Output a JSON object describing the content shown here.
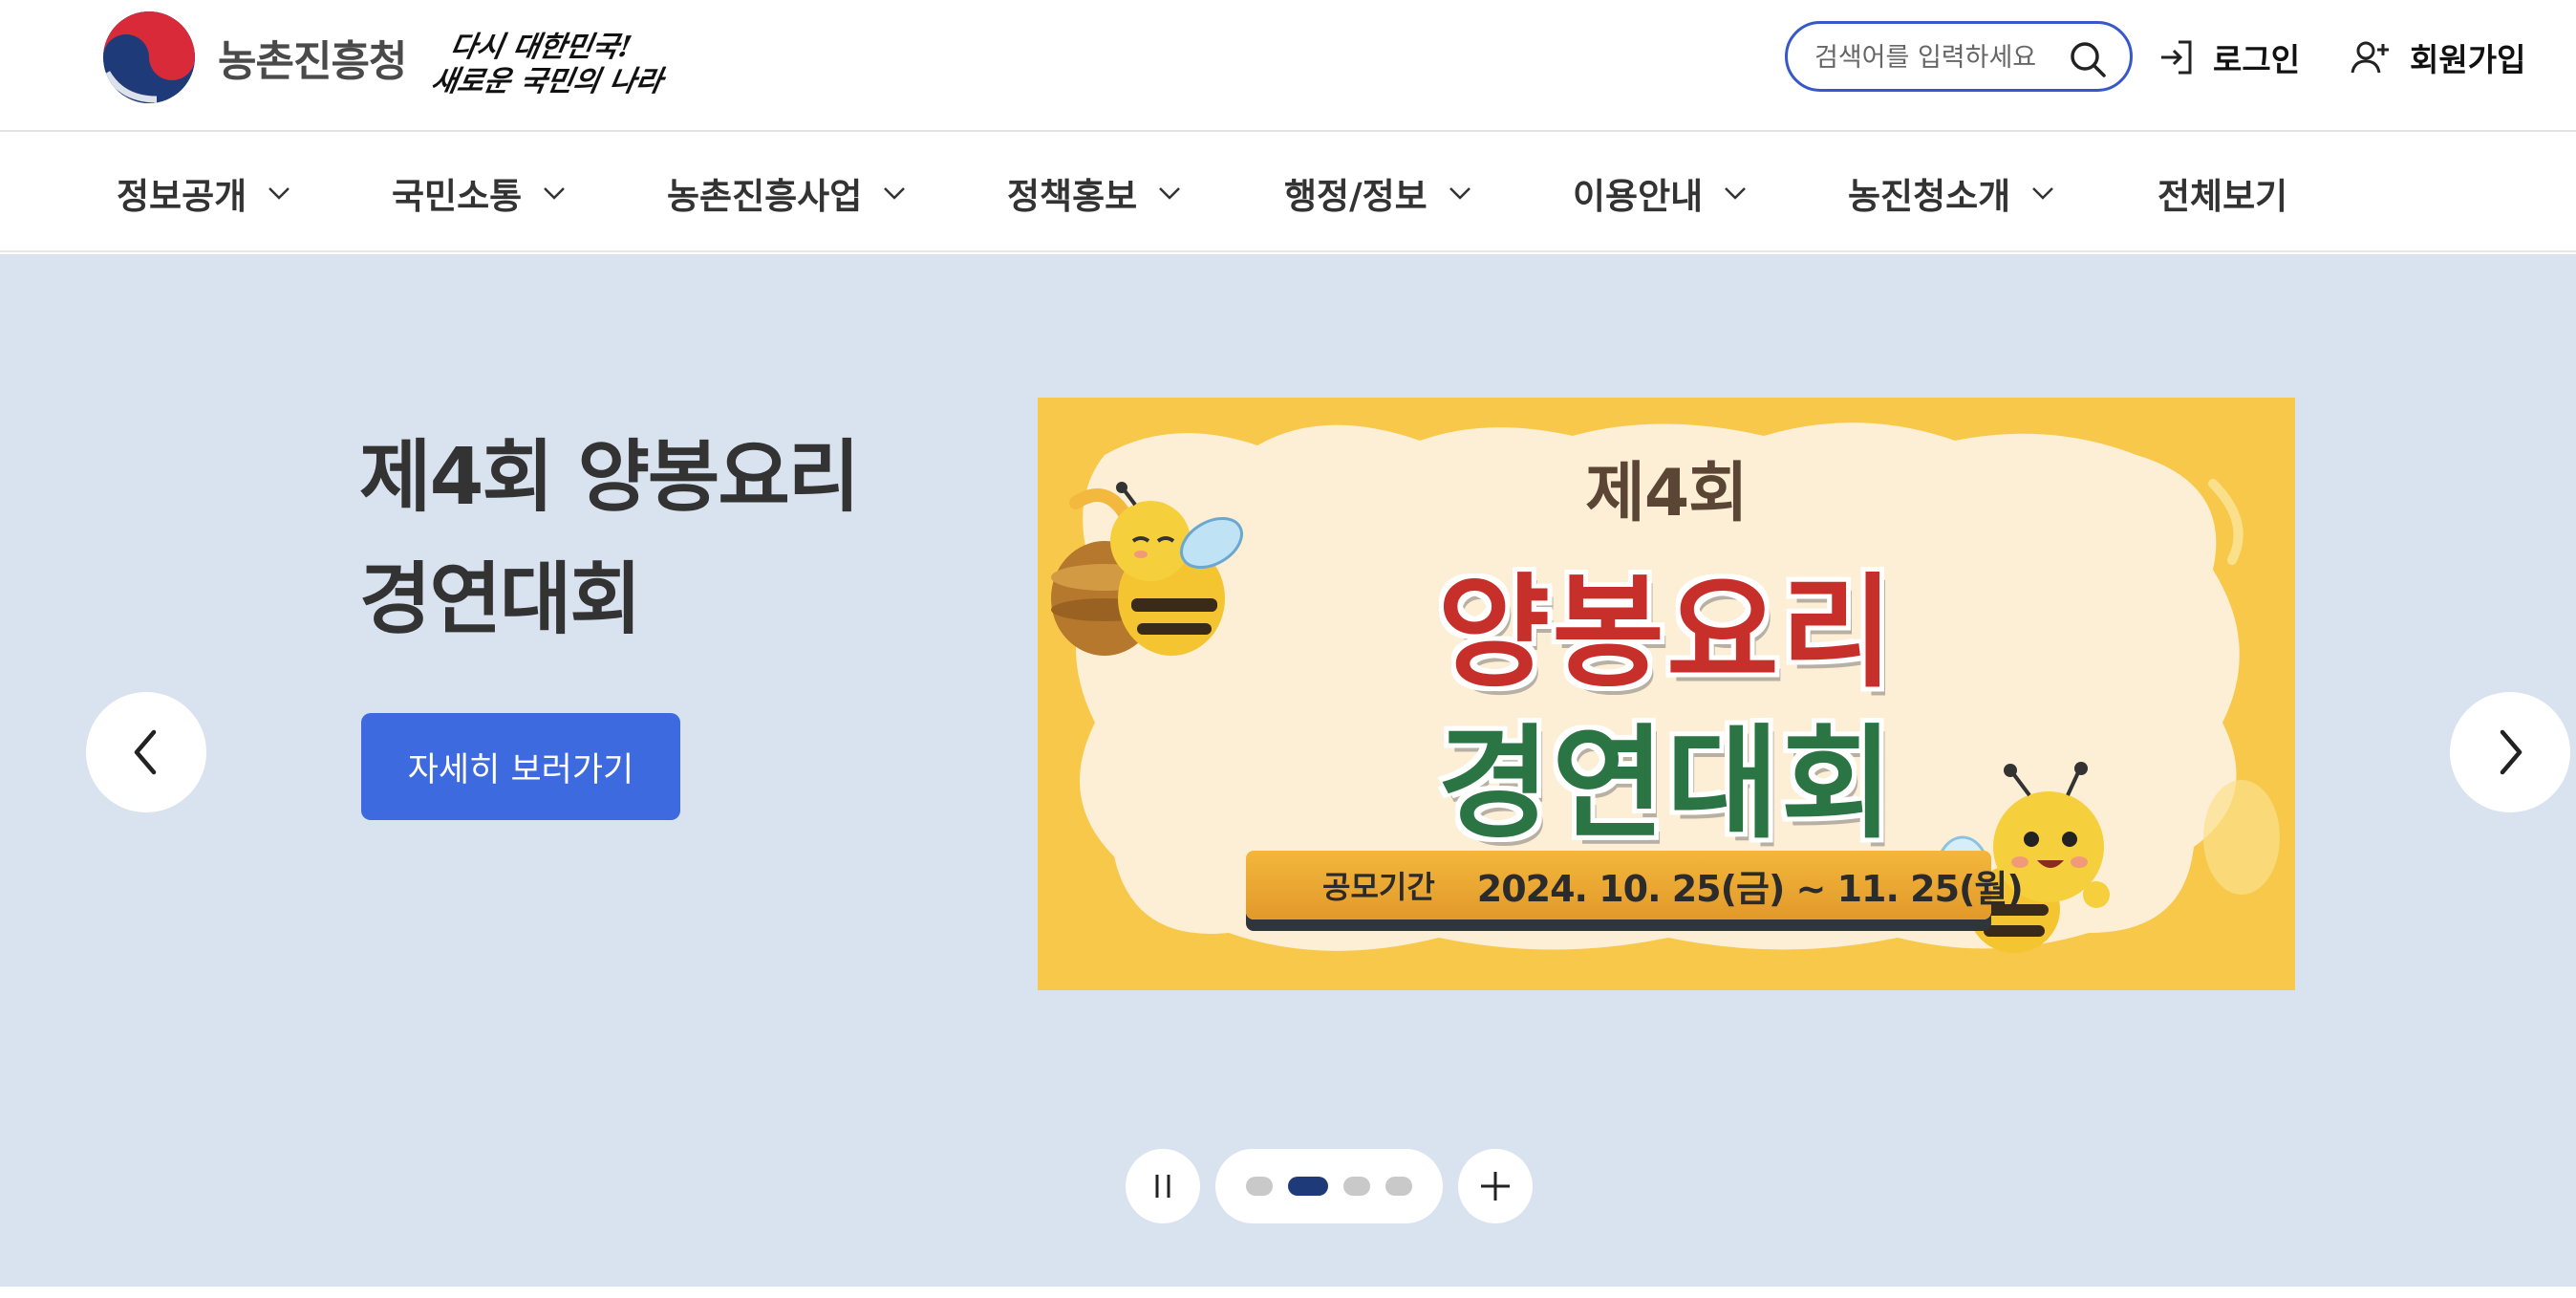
{
  "header": {
    "org_name": "농촌진흥청",
    "slogan_line1": "다시 대한민국!",
    "slogan_line2": "새로운 국민의 나라",
    "search_placeholder": "검색어를 입력하세요",
    "login_label": "로그인",
    "signup_label": "회원가입"
  },
  "nav": {
    "items": [
      {
        "label": "정보공개",
        "has_dropdown": true
      },
      {
        "label": "국민소통",
        "has_dropdown": true
      },
      {
        "label": "농촌진흥사업",
        "has_dropdown": true
      },
      {
        "label": "정책홍보",
        "has_dropdown": true
      },
      {
        "label": "행정/정보",
        "has_dropdown": true
      },
      {
        "label": "이용안내",
        "has_dropdown": true
      },
      {
        "label": "농진청소개",
        "has_dropdown": true
      },
      {
        "label": "전체보기",
        "has_dropdown": false
      }
    ]
  },
  "hero": {
    "title_line1": "제4회 양봉요리",
    "title_line2": "경연대회",
    "detail_button": "자세히 보러가기",
    "banner": {
      "round": "제4회",
      "line1": "양봉요리",
      "line2": "경연대회",
      "period_label": "공모기간",
      "period_dates": "2024. 10. 25(금) ~ 11. 25(월)"
    },
    "slides_total": 4,
    "active_slide": 2
  },
  "icons": {
    "search": "search-icon",
    "login": "login-icon",
    "signup": "user-plus-icon",
    "prev": "chevron-left-icon",
    "next": "chevron-right-icon",
    "pause": "pause-icon",
    "more": "plus-icon"
  },
  "colors": {
    "accent": "#3e6ae0",
    "hero_bg": "#d9e3f0",
    "search_border": "#3758c9",
    "active_dot": "#1e3a78"
  }
}
